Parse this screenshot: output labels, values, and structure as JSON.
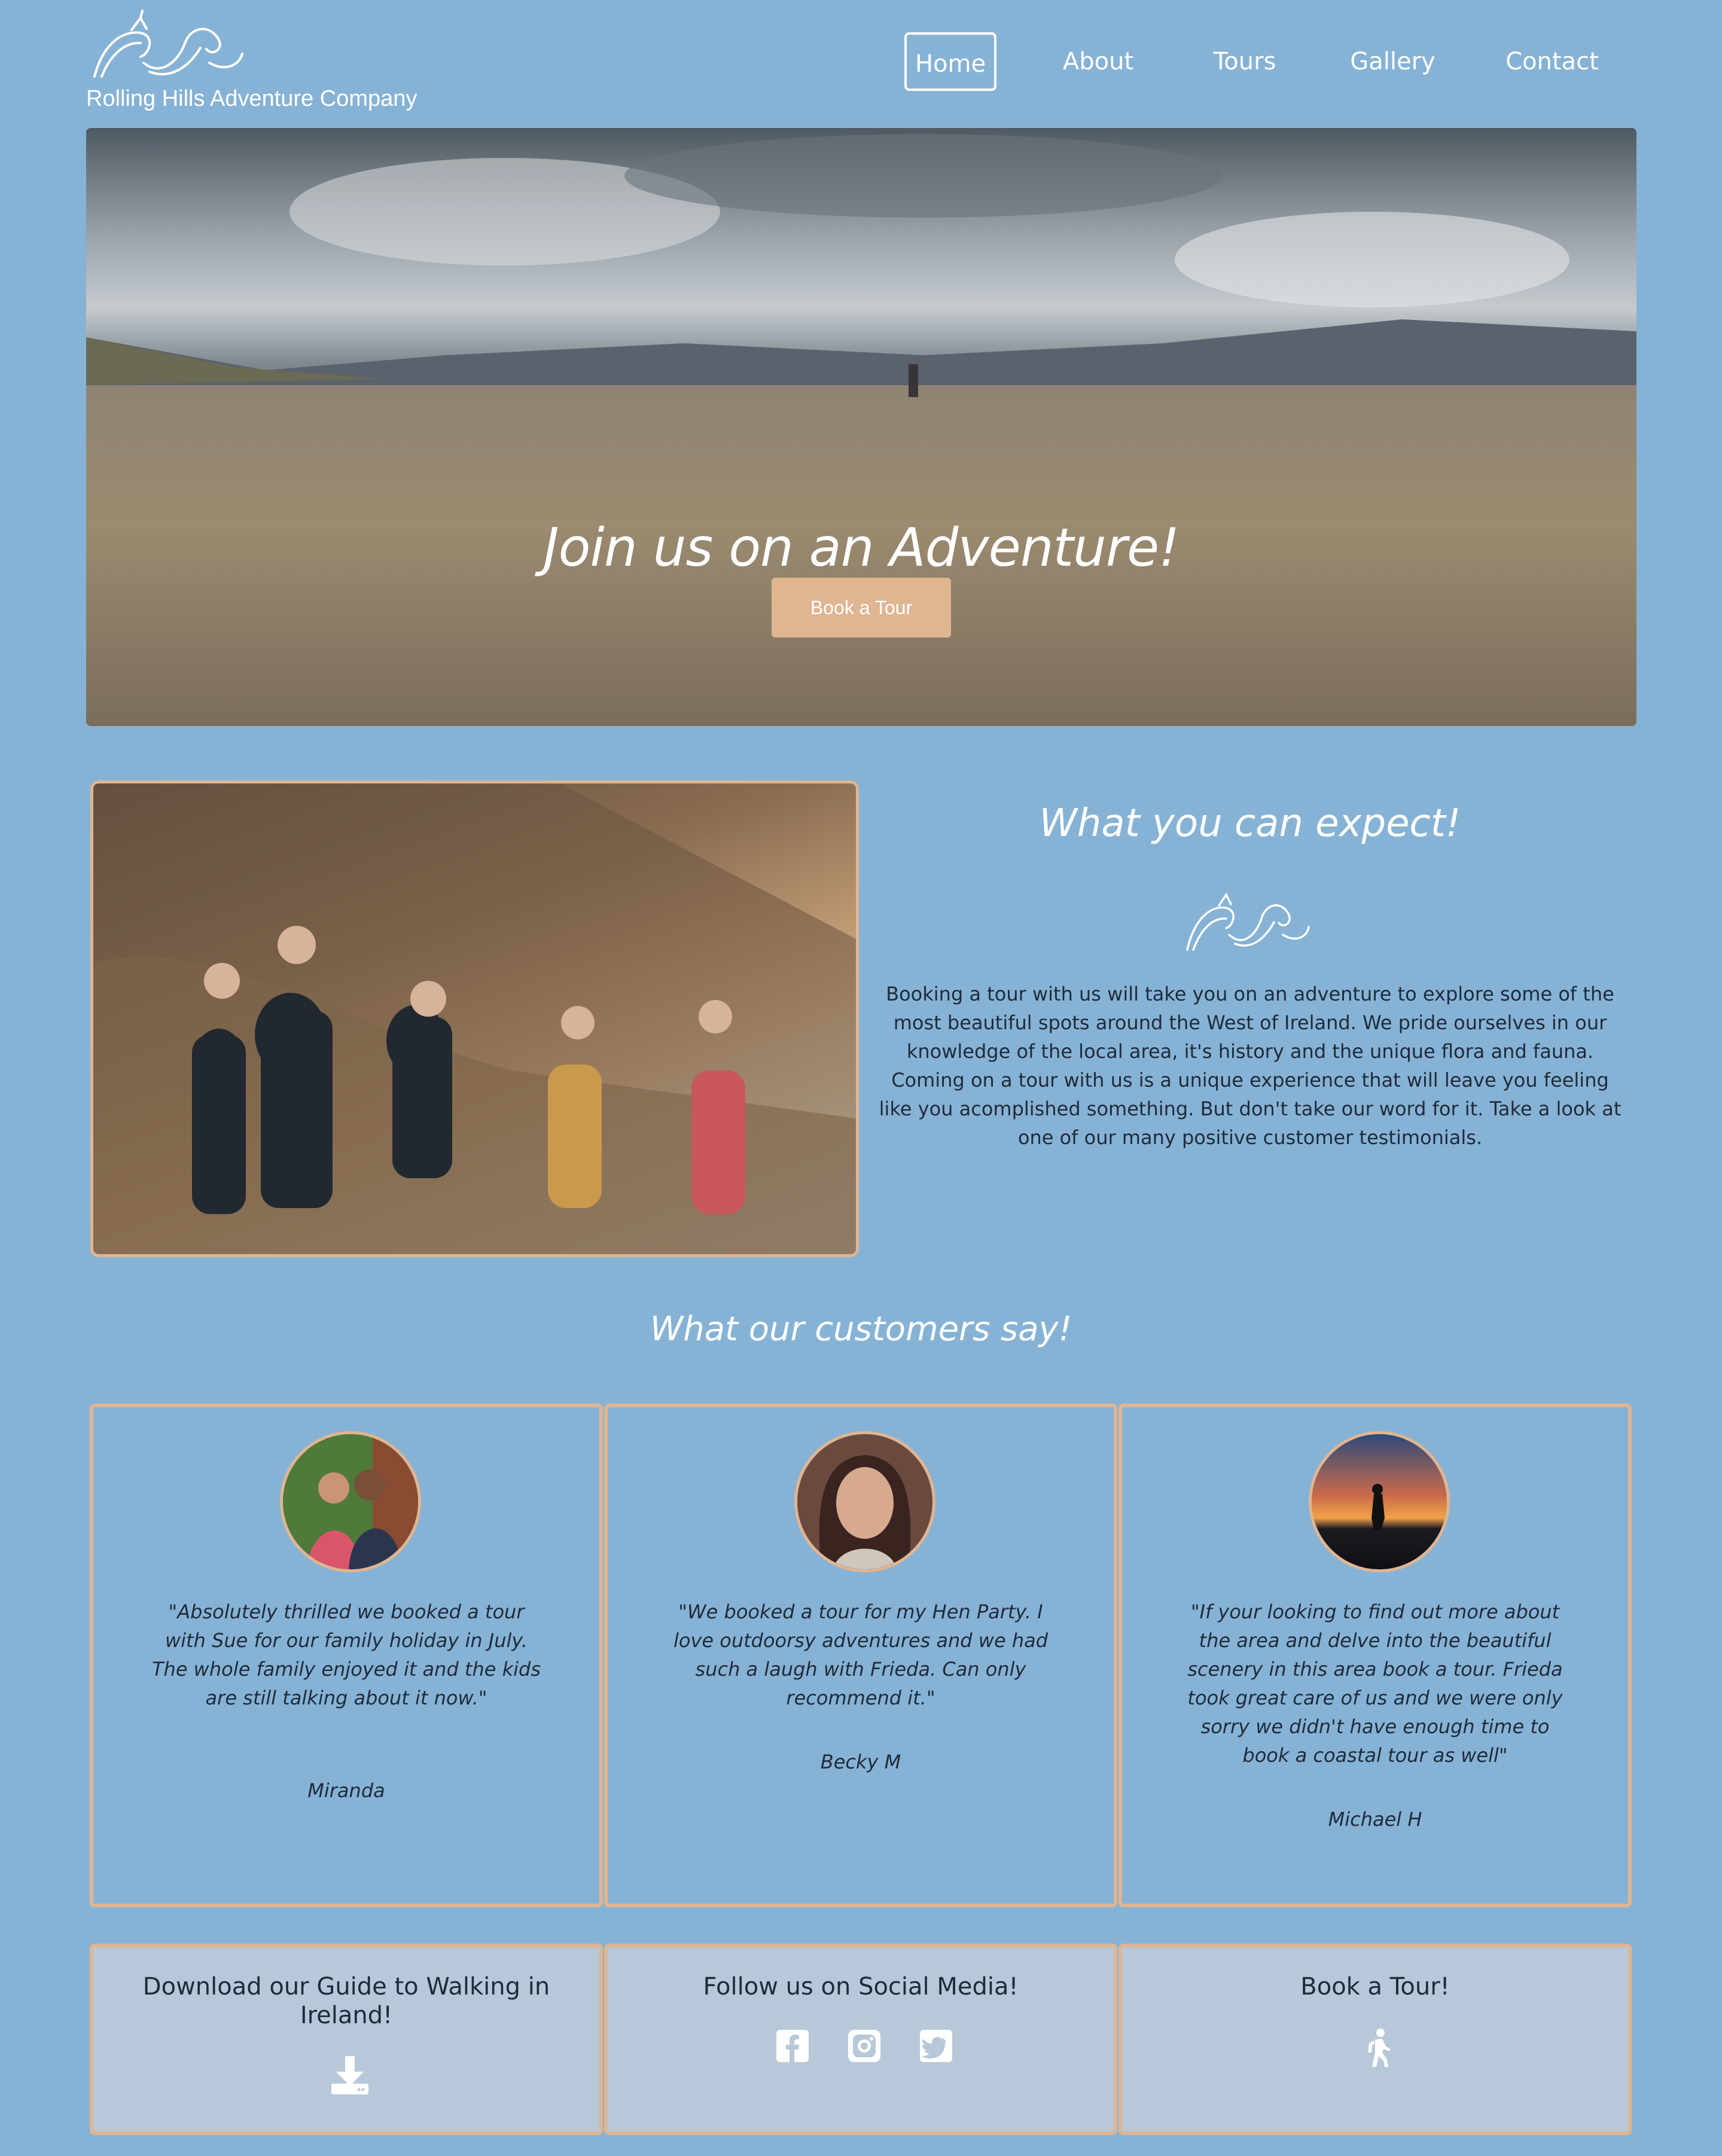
{
  "header": {
    "brand_name": "Rolling Hills Adventure Company",
    "logo_icon": "wave-logo-icon",
    "nav": [
      {
        "label": "Home",
        "active": true
      },
      {
        "label": "About",
        "active": false
      },
      {
        "label": "Tours",
        "active": false
      },
      {
        "label": "Gallery",
        "active": false
      },
      {
        "label": "Contact",
        "active": false
      }
    ]
  },
  "hero": {
    "title": "Join us on an Adventure!",
    "button_label": "Book a Tour"
  },
  "expect": {
    "title": "What you can expect!",
    "text": "Booking a tour with us will take you on an adventure to explore some of the most beautiful spots around the West of Ireland. We pride ourselves in our knowledge of the local area, it's history and the unique flora and fauna. Coming on a tour with us is a unique experience that will leave you feeling like you acomplished something. But don't take our word for it. Take a look at one of our many positive customer testimonials."
  },
  "testimonials": {
    "title": "What our customers say!",
    "items": [
      {
        "quote": "\"Absolutely thrilled we booked a tour with Sue for our family holiday in July. The whole family enjoyed it and the kids are still talking about it now.\"",
        "author": "Miranda"
      },
      {
        "quote": "\"We booked a tour for my Hen Party. I love outdoorsy adventures and we had such a laugh with Frieda. Can only recommend it.\"",
        "author": "Becky M"
      },
      {
        "quote": "\"If your looking to find out more about the area and delve into the beautiful scenery in this area book a tour. Frieda took great care of us and we were only sorry we didn't have enough time to book a coastal tour as well\"",
        "author": "Michael H"
      }
    ]
  },
  "footer_boxes": [
    {
      "title": "Download our Guide to Walking in Ireland!",
      "icon": "download-icon"
    },
    {
      "title": "Follow us on Social Media!",
      "icons": [
        "facebook-icon",
        "instagram-icon",
        "twitter-icon"
      ]
    },
    {
      "title": "Book a Tour!",
      "icon": "hiking-icon"
    }
  ],
  "colors": {
    "background": "#86b3d5",
    "accent": "#e0b591",
    "text_dark": "#1f2a3a",
    "box_bg": "#b7c8d8"
  }
}
